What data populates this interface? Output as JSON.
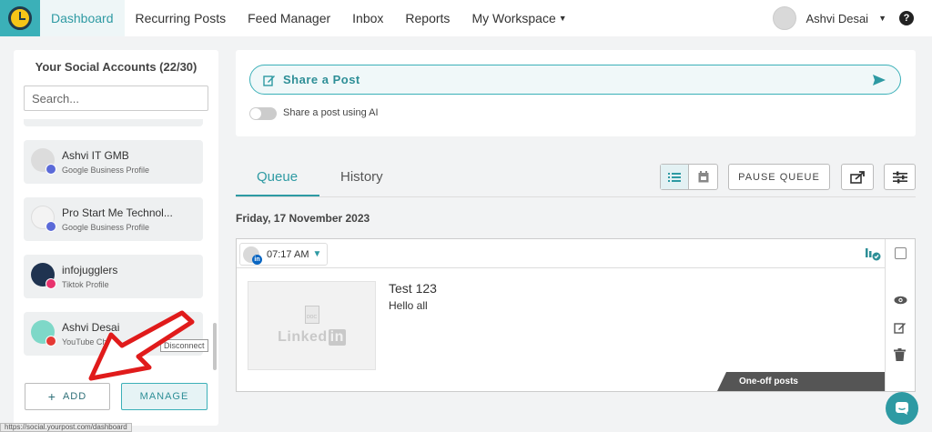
{
  "nav": {
    "items": [
      {
        "label": "Dashboard",
        "active": true
      },
      {
        "label": "Recurring Posts"
      },
      {
        "label": "Feed Manager"
      },
      {
        "label": "Inbox"
      },
      {
        "label": "Reports"
      },
      {
        "label": "My Workspace"
      }
    ],
    "user_name": "Ashvi Desai",
    "help_label": "?"
  },
  "accounts": {
    "title": "Your Social Accounts (22/30)",
    "search_placeholder": "Search...",
    "items": [
      {
        "name": "Ashvi IT GMB",
        "type": "Google Business Profile",
        "badge_color": "#5b6ad8"
      },
      {
        "name": "Pro Start Me Technol...",
        "type": "Google Business Profile",
        "badge_color": "#5b6ad8"
      },
      {
        "name": "infojugglers",
        "type": "Tiktok Profile",
        "badge_color": "#e8336e"
      },
      {
        "name": "Ashvi Desai",
        "type": "YouTube Chan",
        "badge_color": "#e53935"
      }
    ],
    "tooltip": "Disconnect",
    "add_label": "ADD",
    "manage_label": "MANAGE"
  },
  "share": {
    "placeholder": "Share a Post",
    "ai_toggle_label": "Share a post using AI"
  },
  "queue": {
    "tabs": [
      {
        "label": "Queue",
        "active": true
      },
      {
        "label": "History"
      }
    ],
    "pause_label": "PAUSE QUEUE",
    "date_heading": "Friday, 17 November 2023"
  },
  "post": {
    "time": "07:17 AM",
    "title": "Test 123",
    "body": "Hello all",
    "thumb_doc": "DOC",
    "thumb_brand": "Linked",
    "thumb_brand_in": "in",
    "tag": "One-off posts"
  },
  "status_url": "https://social.yourpost.com/dashboard",
  "colors": {
    "accent": "#2e9aa3",
    "logo_bg": "#3bb0b8",
    "annotation": "#e01b1b"
  }
}
